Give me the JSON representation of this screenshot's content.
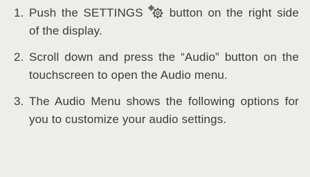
{
  "instructions": {
    "steps": [
      {
        "number": "1.",
        "text_before": "Push the SETTINGS",
        "icon": "gear-icon",
        "text_after": "button on the right side of the display."
      },
      {
        "number": "2.",
        "text": "Scroll down and press the “Audio” button on the touchscreen to open the Audio menu."
      },
      {
        "number": "3.",
        "text": "The Audio Menu shows the following options for you to customize your audio settings."
      }
    ]
  }
}
